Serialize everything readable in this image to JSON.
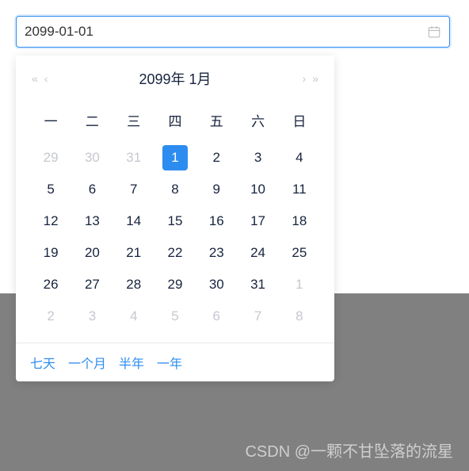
{
  "input": {
    "value": "2099-01-01"
  },
  "header": {
    "title": "2099年 1月"
  },
  "weekdays": [
    "一",
    "二",
    "三",
    "四",
    "五",
    "六",
    "日"
  ],
  "days": [
    {
      "d": 29,
      "other": true
    },
    {
      "d": 30,
      "other": true
    },
    {
      "d": 31,
      "other": true
    },
    {
      "d": 1,
      "selected": true
    },
    {
      "d": 2
    },
    {
      "d": 3
    },
    {
      "d": 4
    },
    {
      "d": 5
    },
    {
      "d": 6
    },
    {
      "d": 7
    },
    {
      "d": 8
    },
    {
      "d": 9
    },
    {
      "d": 10
    },
    {
      "d": 11
    },
    {
      "d": 12
    },
    {
      "d": 13
    },
    {
      "d": 14
    },
    {
      "d": 15
    },
    {
      "d": 16
    },
    {
      "d": 17
    },
    {
      "d": 18
    },
    {
      "d": 19
    },
    {
      "d": 20
    },
    {
      "d": 21
    },
    {
      "d": 22
    },
    {
      "d": 23
    },
    {
      "d": 24
    },
    {
      "d": 25
    },
    {
      "d": 26
    },
    {
      "d": 27
    },
    {
      "d": 28
    },
    {
      "d": 29
    },
    {
      "d": 30
    },
    {
      "d": 31
    },
    {
      "d": 1,
      "other": true
    },
    {
      "d": 2,
      "other": true
    },
    {
      "d": 3,
      "other": true
    },
    {
      "d": 4,
      "other": true
    },
    {
      "d": 5,
      "other": true
    },
    {
      "d": 6,
      "other": true
    },
    {
      "d": 7,
      "other": true
    },
    {
      "d": 8,
      "other": true
    }
  ],
  "footer": {
    "seven_days": "七天",
    "one_month": "一个月",
    "half_year": "半年",
    "one_year": "一年"
  },
  "watermark": "CSDN @一颗不甘坠落的流星"
}
